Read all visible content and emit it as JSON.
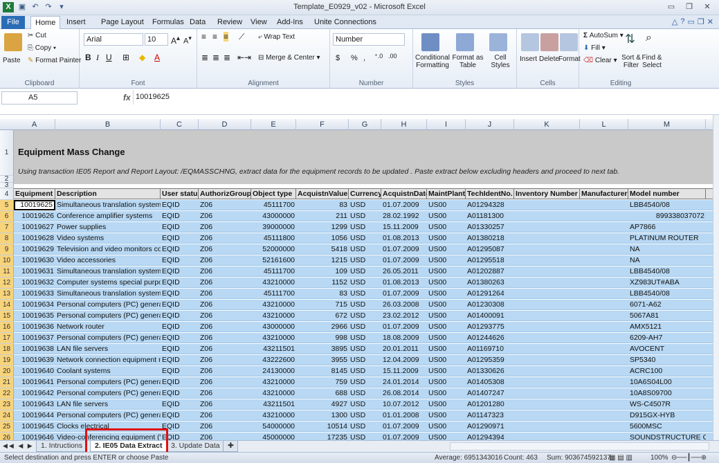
{
  "window": {
    "title": "Template_E0929_v02 - Microsoft Excel",
    "app_letter": "X"
  },
  "tabs": [
    "File",
    "Home",
    "Insert",
    "Page Layout",
    "Formulas",
    "Data",
    "Review",
    "View",
    "Add-Ins",
    "Unite Connections"
  ],
  "ribbon": {
    "clipboard": {
      "paste": "Paste",
      "cut": "Cut",
      "copy": "Copy",
      "format_painter": "Format Painter",
      "label": "Clipboard"
    },
    "font": {
      "name": "Arial",
      "size": "10",
      "label": "Font"
    },
    "alignment": {
      "wrap": "Wrap Text",
      "merge": "Merge & Center",
      "label": "Alignment"
    },
    "number": {
      "format": "Number",
      "currency": "$",
      "percent": "%",
      "comma": ",",
      "label": "Number"
    },
    "styles": {
      "conditional": "Conditional Formatting",
      "format_table": "Format as Table",
      "cell_styles": "Cell Styles",
      "label": "Styles"
    },
    "cells": {
      "insert": "Insert",
      "delete": "Delete",
      "format": "Format",
      "label": "Cells"
    },
    "editing": {
      "autosum": "AutoSum",
      "fill": "Fill",
      "clear": "Clear",
      "sort": "Sort & Filter",
      "find": "Find & Select",
      "label": "Editing"
    }
  },
  "formula_bar": {
    "cell": "A5",
    "fx": "fx",
    "value": "10019625"
  },
  "columns": [
    "A",
    "B",
    "C",
    "D",
    "E",
    "F",
    "G",
    "H",
    "I",
    "J",
    "K",
    "L",
    "M"
  ],
  "sheet": {
    "title": "Equipment Mass Change",
    "instruction": "Using transaction IE05 Report and Report Layout: /EQMASSCHNG, extract data for the equipment records to be updated . Paste extract below excluding headers and proceed to next tab.",
    "headers": [
      "Equipment",
      "Description",
      "User status",
      "AuthorizGroup",
      "Object type",
      "AcquistnValue",
      "Currency",
      "AcquistnDate",
      "MaintPlant",
      "TechIdentNo.",
      "Inventory Number",
      "Manufacturer",
      "Model number"
    ],
    "rows": [
      [
        "10019625",
        "Simultaneous translation systems pa",
        "EQID",
        "Z06",
        "45111700",
        "83",
        "USD",
        "01.07.2009",
        "US00",
        "A01294328",
        "",
        "",
        "LBB4540/08"
      ],
      [
        "10019626",
        "Conference amplifier systems",
        "EQID",
        "Z06",
        "43000000",
        "211",
        "USD",
        "28.02.1992",
        "US00",
        "A01181300",
        "",
        "",
        "899338037072"
      ],
      [
        "10019627",
        "Power supplies",
        "EQID",
        "Z06",
        "39000000",
        "1299",
        "USD",
        "15.11.2009",
        "US00",
        "A01330257",
        "",
        "",
        "AP7866"
      ],
      [
        "10019628",
        "Video systems",
        "EQID",
        "Z06",
        "45111800",
        "1056",
        "USD",
        "01.08.2013",
        "US00",
        "A01380218",
        "",
        "",
        "PLATINUM ROUTER"
      ],
      [
        "10019629",
        "Television and video monitors colour |",
        "EQID",
        "Z06",
        "52000000",
        "5418",
        "USD",
        "01.07.2009",
        "US00",
        "A01295087",
        "",
        "",
        "NA"
      ],
      [
        "10019630",
        "Video accessories",
        "EQID",
        "Z06",
        "52161600",
        "1215",
        "USD",
        "01.07.2009",
        "US00",
        "A01295518",
        "",
        "",
        "NA"
      ],
      [
        "10019631",
        "Simultaneous translation systems pa",
        "EQID",
        "Z06",
        "45111700",
        "109",
        "USD",
        "26.05.2011",
        "US00",
        "A01202887",
        "",
        "",
        "LBB4540/08"
      ],
      [
        "10019632",
        "Computer systems special purpose c",
        "EQID",
        "Z06",
        "43210000",
        "1152",
        "USD",
        "01.08.2013",
        "US00",
        "A01380263",
        "",
        "",
        "XZ983UT#ABA"
      ],
      [
        "10019633",
        "Simultaneous translation systems pa",
        "EQID",
        "Z06",
        "45111700",
        "83",
        "USD",
        "01.07.2009",
        "US00",
        "A01291264",
        "",
        "",
        "LBB4540/08"
      ],
      [
        "10019634",
        "Personal computers (PC) general pur",
        "EQID",
        "Z06",
        "43210000",
        "715",
        "USD",
        "26.03.2008",
        "US00",
        "A01230308",
        "",
        "",
        "6071-A62"
      ],
      [
        "10019635",
        "Personal computers (PC) general pur",
        "EQID",
        "Z06",
        "43210000",
        "672",
        "USD",
        "23.02.2012",
        "US00",
        "A01400091",
        "",
        "",
        "5067A81"
      ],
      [
        "10019636",
        "Network router",
        "EQID",
        "Z06",
        "43000000",
        "2966",
        "USD",
        "01.07.2009",
        "US00",
        "A01293775",
        "",
        "",
        "AMX5121"
      ],
      [
        "10019637",
        "Personal computers (PC) general pur",
        "EQID",
        "Z06",
        "43210000",
        "998",
        "USD",
        "18.08.2009",
        "US00",
        "A01244626",
        "",
        "",
        "6209-AH7"
      ],
      [
        "10019638",
        "LAN file servers",
        "EQID",
        "Z06",
        "43211501",
        "3895",
        "USD",
        "20.01.2011",
        "US00",
        "A01169710",
        "",
        "",
        "AVOCENT"
      ],
      [
        "10019639",
        "Network connection equipment misc",
        "EQID",
        "Z06",
        "43222600",
        "3955",
        "USD",
        "12.04.2009",
        "US00",
        "A01295359",
        "",
        "",
        "SP5340"
      ],
      [
        "10019640",
        "Coolant systems",
        "EQID",
        "Z06",
        "24130000",
        "8145",
        "USD",
        "15.11.2009",
        "US00",
        "A01330626",
        "",
        "",
        "ACRC100"
      ],
      [
        "10019641",
        "Personal computers (PC) general pur",
        "EQID",
        "Z06",
        "43210000",
        "759",
        "USD",
        "24.01.2014",
        "US00",
        "A01405308",
        "",
        "",
        "10A6S04L00"
      ],
      [
        "10019642",
        "Personal computers (PC) general pur",
        "EQID",
        "Z06",
        "43210000",
        "688",
        "USD",
        "26.08.2014",
        "US00",
        "A01407247",
        "",
        "",
        "10A8S09700"
      ],
      [
        "10019643",
        "LAN file servers",
        "EQID",
        "Z06",
        "43211501",
        "4927",
        "USD",
        "10.07.2012",
        "US00",
        "A01201280",
        "",
        "",
        "WS-C4507R"
      ],
      [
        "10019644",
        "Personal computers (PC) general pur",
        "EQID",
        "Z06",
        "43210000",
        "1300",
        "USD",
        "01.01.2008",
        "US00",
        "A01147323",
        "",
        "",
        "D915GX-HYB"
      ],
      [
        "10019645",
        "Clocks electrical",
        "EQID",
        "Z06",
        "54000000",
        "10514",
        "USD",
        "01.07.2009",
        "US00",
        "A01290971",
        "",
        "",
        "5600MSC"
      ],
      [
        "10019646",
        "Video-conferencing equipment (VDT)",
        "EQID",
        "Z06",
        "45000000",
        "17235",
        "USD",
        "01.07.2009",
        "US00",
        "A01294394",
        "",
        "",
        "SOUNDSTRUCTURE C"
      ]
    ],
    "row_numbers": [
      "1",
      "2",
      "3",
      "4",
      "5",
      "6",
      "7",
      "8",
      "9",
      "10",
      "11",
      "12",
      "13",
      "14",
      "15",
      "16",
      "17",
      "18",
      "19",
      "20",
      "21",
      "22",
      "23",
      "24",
      "25",
      "26"
    ]
  },
  "sheet_tabs": [
    "1. Intructions",
    "2. IE05 Data Extract",
    "3. Update Data"
  ],
  "status": {
    "message": "Select destination and press ENTER or choose Paste",
    "average": "Average: 6951343016",
    "count": "Count: 463",
    "sum": "Sum: 903674592137",
    "zoom": "100%"
  }
}
